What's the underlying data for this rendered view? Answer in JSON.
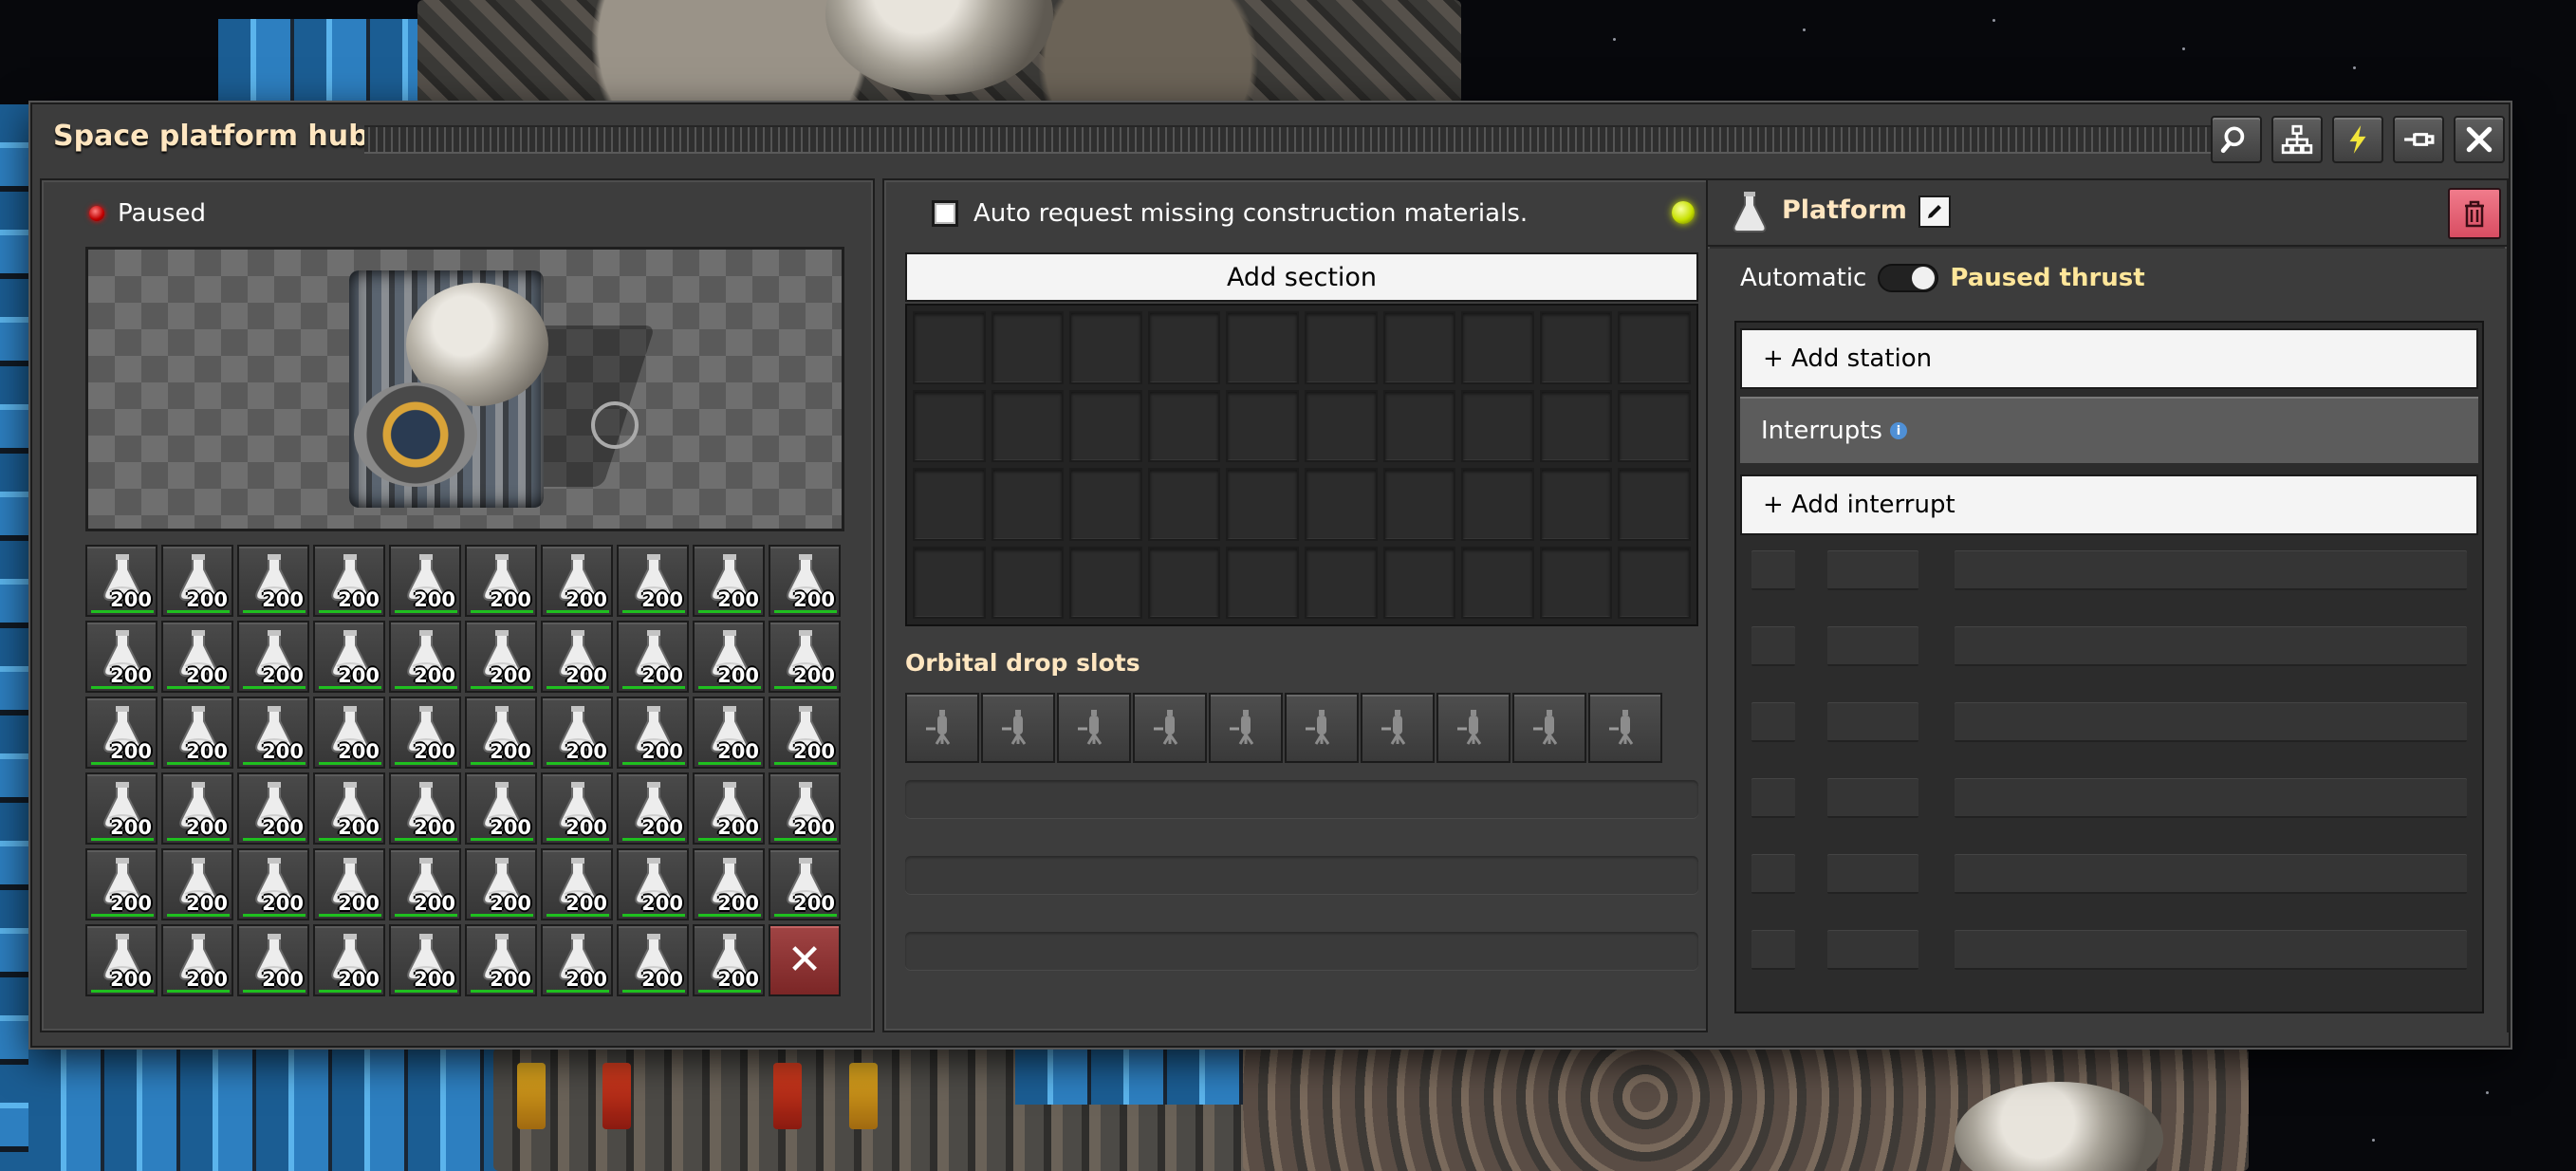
{
  "window": {
    "title": "Space platform hub",
    "buttons": [
      {
        "name": "search-button",
        "icon": "magnifier-icon"
      },
      {
        "name": "network-button",
        "icon": "network-tree-icon"
      },
      {
        "name": "power-button",
        "icon": "lightning-icon"
      },
      {
        "name": "pin-button",
        "icon": "pin-icon"
      },
      {
        "name": "close-button",
        "icon": "close-icon"
      }
    ]
  },
  "left_panel": {
    "status": "Paused",
    "status_color": "#d40000",
    "inventory": {
      "slot_count": "200",
      "item_icon": "flask-icon",
      "filled_slots": 59
    }
  },
  "middle_panel": {
    "auto_request_label": "Auto request missing construction materials.",
    "auto_request_checked": false,
    "indicator_color": "#c7e000",
    "add_section_label": "Add section",
    "orbital_drop_label": "Orbital drop slots",
    "orbital_slot_icon": "cargo-pod-icon"
  },
  "right_panel": {
    "title": "Platform",
    "automatic_label": "Automatic",
    "paused_thrust_label": "Paused thrust",
    "add_station_label": "+ Add station",
    "interrupts_label": "Interrupts",
    "add_interrupt_label": "+ Add interrupt",
    "delete_color": "#e85d72"
  },
  "colors": {
    "title_text": "#ffe6c0",
    "slot_bar": "#1fbf1f"
  }
}
